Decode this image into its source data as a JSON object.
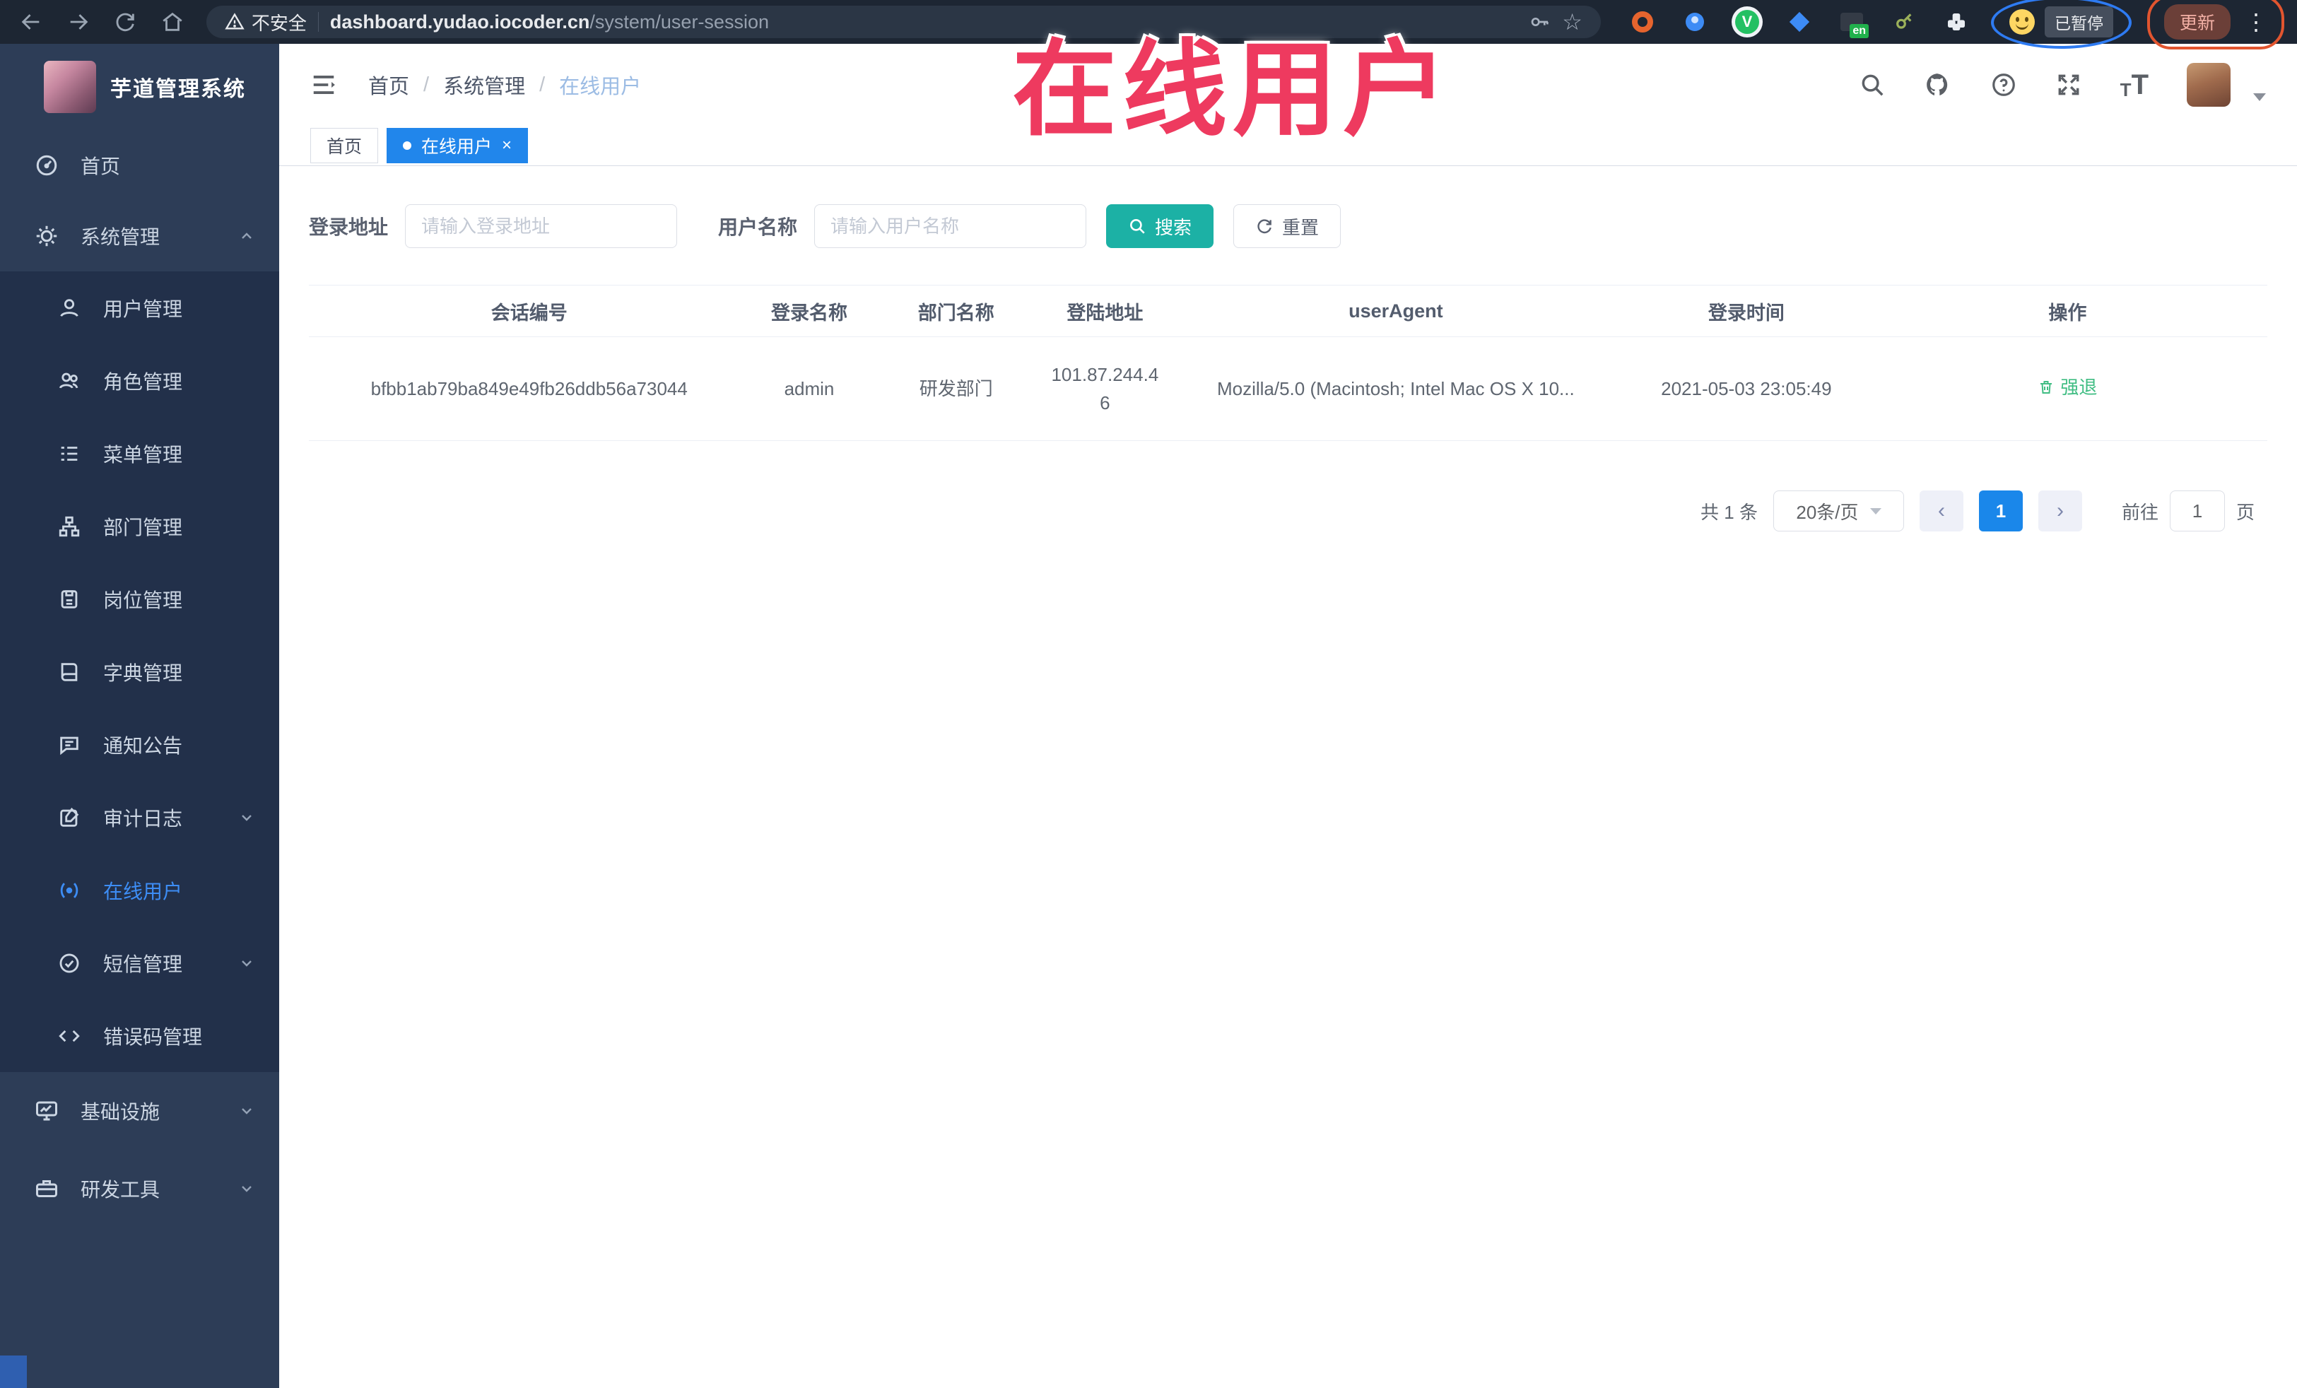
{
  "browser": {
    "security_warning": "不安全",
    "url_domain": "dashboard.yudao.iocoder.cn",
    "url_path": "/system/user-session",
    "en_badge": "en",
    "paused_badge": "已暂停",
    "update_button": "更新"
  },
  "annotation": {
    "overlay_title": "在线用户"
  },
  "icons": {
    "star": "☆",
    "more_vert": "⋮",
    "help": "?",
    "close": "×",
    "prev": "‹",
    "next": "›",
    "t_small": "T",
    "t_large": "T",
    "ext_v": "V"
  },
  "sidebar": {
    "app_title": "芋道管理系统",
    "items": [
      {
        "label": "首页"
      },
      {
        "label": "系统管理"
      },
      {
        "label": "用户管理"
      },
      {
        "label": "角色管理"
      },
      {
        "label": "菜单管理"
      },
      {
        "label": "部门管理"
      },
      {
        "label": "岗位管理"
      },
      {
        "label": "字典管理"
      },
      {
        "label": "通知公告"
      },
      {
        "label": "审计日志"
      },
      {
        "label": "在线用户"
      },
      {
        "label": "短信管理"
      },
      {
        "label": "错误码管理"
      },
      {
        "label": "基础设施"
      },
      {
        "label": "研发工具"
      }
    ]
  },
  "breadcrumb": {
    "sep": "/",
    "items": [
      "首页",
      "系统管理",
      "在线用户"
    ]
  },
  "tabs": [
    {
      "label": "首页"
    },
    {
      "label": "在线用户"
    }
  ],
  "filters": {
    "login_address_label": "登录地址",
    "login_address_placeholder": "请输入登录地址",
    "username_label": "用户名称",
    "username_placeholder": "请输入用户名称",
    "search_label": "搜索",
    "reset_label": "重置"
  },
  "table": {
    "headers": [
      "会话编号",
      "登录名称",
      "部门名称",
      "登陆地址",
      "userAgent",
      "登录时间",
      "操作"
    ],
    "rows": [
      {
        "session_id": "bfbb1ab79ba849e49fb26ddb56a73044",
        "login_name": "admin",
        "dept_name": "研发部门",
        "login_address": "101.87.244.46",
        "user_agent": "Mozilla/5.0 (Macintosh; Intel Mac OS X 10...",
        "login_time": "2021-05-03 23:05:49",
        "action": "强退"
      }
    ]
  },
  "pagination": {
    "total": "共 1 条",
    "page_size": "20条/页",
    "current_page": "1",
    "goto_label": "前往",
    "goto_value": "1",
    "page_unit": "页"
  },
  "colors": {
    "accent_blue": "#1a87ea",
    "teal_button": "#1cb1a5",
    "success_green": "#40bd83",
    "annotation_red": "#ee3a5f",
    "annotation_blue": "#2e7bf2",
    "annotation_orange": "#e2552f",
    "sidebar_bg": "#2d3d57",
    "sidebar_sub_bg": "#22304a",
    "chrome_bg": "#1d2633"
  }
}
